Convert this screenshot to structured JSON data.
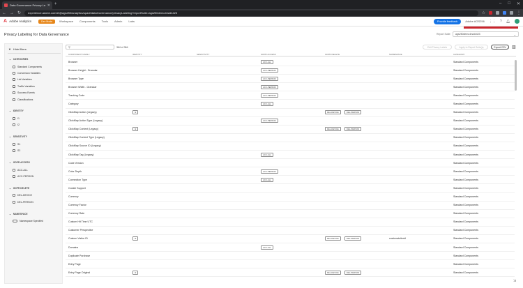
{
  "browser": {
    "tab_title": "Data Governance Privacy Labeli...",
    "url": "experience.adobe.com/#/@ags250/analytics/spa/#/dataGovernance/privacyLabeling?reportSuite=ags250demo4rsid4423",
    "icons": [
      "back-icon",
      "forward-icon",
      "reload-icon",
      "info-icon"
    ]
  },
  "app": {
    "name": "Adobe Analytics",
    "dev_mode": "Dev Mode",
    "nav": [
      "Workspace",
      "Components",
      "Tools",
      "Admin",
      "Labs"
    ],
    "feedback": "Provide feedback",
    "org": "Adobe AGS256"
  },
  "page": {
    "title": "Privacy Labeling for Data Governance",
    "report_suite_label": "Report Suite:",
    "report_suite_value": "ags250demo4rsid4423"
  },
  "filters": {
    "hide_label": "Hide filters",
    "groups": [
      {
        "title": "CATEGORIES",
        "type": "checkbox",
        "options": [
          "Standard Components",
          "Conversion Variables",
          "List Variables",
          "Traffic Variables",
          "Success Events",
          "Classifications"
        ]
      },
      {
        "title": "IDENTITY",
        "type": "checkbox",
        "options": [
          "I1",
          "I2"
        ]
      },
      {
        "title": "SENSITIVITY",
        "type": "checkbox",
        "options": [
          "S1",
          "S2"
        ]
      },
      {
        "title": "GDPR ACCESS",
        "type": "checkbox",
        "options": [
          "ACC-ALL",
          "ACC-PERSON"
        ]
      },
      {
        "title": "GDPR DELETE",
        "type": "checkbox",
        "options": [
          "DEL-DEVICE",
          "DEL-PERSON"
        ]
      },
      {
        "title": "NAMESPACE",
        "type": "toggle",
        "options": [
          "Namespace Specified"
        ]
      }
    ]
  },
  "toolbar": {
    "search_placeholder": "",
    "count": "364 of 364",
    "edit_label": "Edit Privacy Labels",
    "apply_label": "Apply to Report Suite(s)",
    "export_label": "Export CSV"
  },
  "table": {
    "columns": [
      "COMPONENT NAME",
      "IDENTITY",
      "SENSITIVITY",
      "GDPR ACCESS",
      "GDPR DELETE",
      "NAMESPACE",
      "CATEGORY"
    ],
    "sort_indicator": "↑",
    "rows": [
      {
        "name": "Browser",
        "identity": "",
        "access": "ACC-ALL",
        "delete": [],
        "namespace": "",
        "category": "Standard Components"
      },
      {
        "name": "Browser Height - Granular",
        "identity": "",
        "access": "ACC-PERSON",
        "delete": [],
        "namespace": "",
        "category": "Standard Components"
      },
      {
        "name": "Browser Type",
        "identity": "",
        "access": "ACC-PERSON",
        "delete": [],
        "namespace": "",
        "category": "Standard Components"
      },
      {
        "name": "Browser Width - Granular",
        "identity": "",
        "access": "ACC-PERSON",
        "delete": [],
        "namespace": "",
        "category": "Standard Components"
      },
      {
        "name": "Tracking Code",
        "identity": "",
        "access": "ACC-PERSON",
        "delete": [],
        "namespace": "",
        "category": "Standard Components"
      },
      {
        "name": "Category",
        "identity": "",
        "access": "ACC-ALL",
        "delete": [],
        "namespace": "",
        "category": "Standard Components"
      },
      {
        "name": "ClickMap Action (Legacy)",
        "identity": "I2",
        "access": "",
        "delete": [
          "DEL-DEVICE",
          "DEL-PERSON"
        ],
        "namespace": "",
        "category": "Standard Components"
      },
      {
        "name": "ClickMap Action Type (Legacy)",
        "identity": "",
        "access": "ACC-PERSON",
        "delete": [],
        "namespace": "",
        "category": "Standard Components"
      },
      {
        "name": "ClickMap Context (Legacy)",
        "identity": "I2",
        "access": "",
        "delete": [
          "DEL-DEVICE",
          "DEL-PERSON"
        ],
        "namespace": "",
        "category": "Standard Components"
      },
      {
        "name": "ClickMap Context Type (Legacy)",
        "identity": "",
        "access": "",
        "delete": [],
        "namespace": "",
        "category": "Standard Components"
      },
      {
        "name": "ClickMap Source ID (Legacy)",
        "identity": "",
        "access": "",
        "delete": [],
        "namespace": "",
        "category": "Standard Components"
      },
      {
        "name": "ClickMap Tag (Legacy)",
        "identity": "",
        "access": "ACC-ALL",
        "delete": [],
        "namespace": "",
        "category": "Standard Components"
      },
      {
        "name": "Code Version",
        "identity": "",
        "access": "",
        "delete": [],
        "namespace": "",
        "category": "Standard Components"
      },
      {
        "name": "Color Depth",
        "identity": "",
        "access": "ACC-PERSON",
        "delete": [],
        "namespace": "",
        "category": "Standard Components"
      },
      {
        "name": "Connection Type",
        "identity": "",
        "access": "ACC-ALL",
        "delete": [],
        "namespace": "",
        "category": "Standard Components"
      },
      {
        "name": "Cookie Support",
        "identity": "",
        "access": "",
        "delete": [],
        "namespace": "",
        "category": "Standard Components"
      },
      {
        "name": "Currency",
        "identity": "",
        "access": "",
        "delete": [],
        "namespace": "",
        "category": "Standard Components"
      },
      {
        "name": "Currency Factor",
        "identity": "",
        "access": "",
        "delete": [],
        "namespace": "",
        "category": "Standard Components"
      },
      {
        "name": "Currency Rate",
        "identity": "",
        "access": "",
        "delete": [],
        "namespace": "",
        "category": "Standard Components"
      },
      {
        "name": "Custom Hit Time UTC",
        "identity": "",
        "access": "",
        "delete": [],
        "namespace": "",
        "category": "Standard Components"
      },
      {
        "name": "Customer Perspective",
        "identity": "",
        "access": "",
        "delete": [],
        "namespace": "",
        "category": "Standard Components"
      },
      {
        "name": "Custom Visitor ID",
        "identity": "I2",
        "access": "",
        "delete": [
          "DEL-DEVICE",
          "DEL-PERSON"
        ],
        "namespace": "customvisitorid",
        "category": "Standard Components"
      },
      {
        "name": "Domains",
        "identity": "",
        "access": "ACC-ALL",
        "delete": [],
        "namespace": "",
        "category": "Standard Components"
      },
      {
        "name": "Duplicate Purchase",
        "identity": "",
        "access": "",
        "delete": [],
        "namespace": "",
        "category": "Standard Components"
      },
      {
        "name": "Entry Page",
        "identity": "",
        "access": "",
        "delete": [],
        "namespace": "",
        "category": "Standard Components"
      },
      {
        "name": "Entry Page Original",
        "identity": "I2",
        "access": "",
        "delete": [
          "DEL-DEVICE",
          "DEL-PERSON"
        ],
        "namespace": "",
        "category": "Standard Components"
      }
    ]
  }
}
